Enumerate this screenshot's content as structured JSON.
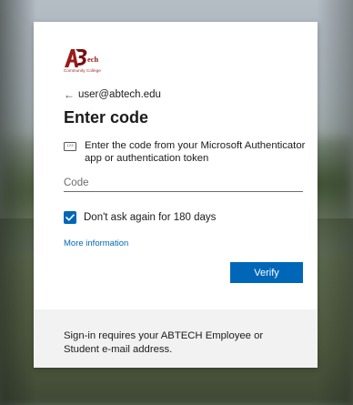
{
  "brand": {
    "logo_text": "ABTech",
    "logo_subtext": "Community College",
    "colors": {
      "red": "#9a1a1a",
      "dark_red": "#7a0f12"
    }
  },
  "identity": {
    "back_icon": "arrow-left-icon",
    "back_glyph": "←",
    "email": "user@abtech.edu"
  },
  "page": {
    "title": "Enter code",
    "instruction_icon": "keypad-icon",
    "instruction_icon_glyph": "123",
    "instruction": "Enter the code from your Microsoft Authenticator app or authentication token"
  },
  "form": {
    "code_placeholder": "Code",
    "code_value": "",
    "remember_label": "Don't ask again for 180 days",
    "remember_checked": true,
    "more_info_label": "More information",
    "verify_label": "Verify"
  },
  "footer": {
    "text": "Sign-in requires your ABTECH Employee or Student e-mail address."
  },
  "colors": {
    "accent": "#0067b8",
    "footer_bg": "#f2f2f2"
  }
}
